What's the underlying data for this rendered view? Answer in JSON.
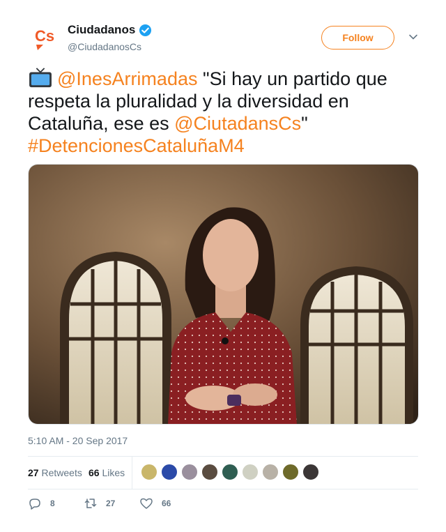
{
  "author": {
    "display_name": "Ciudadanos",
    "handle": "@CiudadanosCs",
    "verified": true,
    "avatar_text": "Cs",
    "brand_color": "#f5821f"
  },
  "follow_label": "Follow",
  "tweet": {
    "emoji": "📺",
    "mention": "@InesArrimadas",
    "quote_text": " \"Si hay un partido que respeta la pluralidad y la diversidad en Cataluña, ese es ",
    "mention2": "@CiutadansCs",
    "closing_quote": "\"",
    "hashtag": "#DetencionesCataluñaM4"
  },
  "timestamp": "5:10 AM - 20 Sep 2017",
  "stats": {
    "retweets_count": "27",
    "retweets_label": "Retweets",
    "likes_count": "66",
    "likes_label": "Likes",
    "liker_colors": [
      "#c9b66a",
      "#2b4aa8",
      "#9a8f9d",
      "#5a4c40",
      "#2f5e52",
      "#cfd0c2",
      "#b8b1a6",
      "#6e6a2a",
      "#3b3636"
    ]
  },
  "actions": {
    "replies": "8",
    "retweets": "27",
    "likes": "66"
  }
}
